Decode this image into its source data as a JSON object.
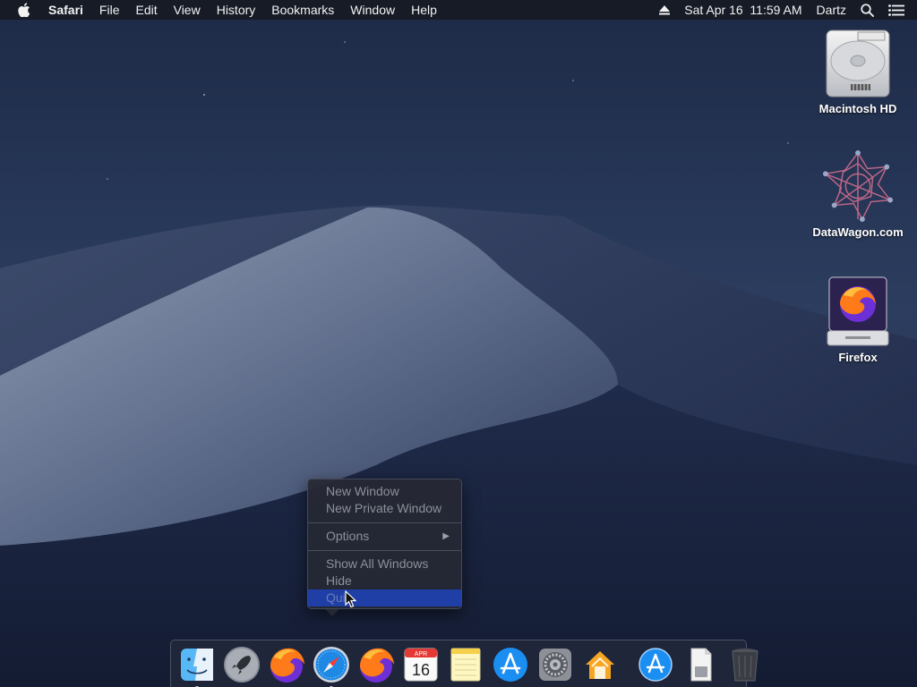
{
  "menubar": {
    "app_name": "Safari",
    "menus": [
      "File",
      "Edit",
      "View",
      "History",
      "Bookmarks",
      "Window",
      "Help"
    ],
    "datetime": "Sat Apr 16  11:59 AM",
    "user": "Dartz",
    "icons": [
      "apple-icon",
      "eject-icon",
      "spotlight-search-icon",
      "notification-center-icon"
    ]
  },
  "desktop": {
    "icons": [
      {
        "label": "Macintosh HD",
        "icon": "hard-drive-icon"
      },
      {
        "label": "DataWagon.com",
        "icon": "network-share-icon"
      },
      {
        "label": "Firefox",
        "icon": "firefox-disk-icon"
      }
    ]
  },
  "context_menu": {
    "items": [
      {
        "label": "New Window"
      },
      {
        "label": "New Private Window"
      },
      {
        "label": "Options",
        "submenu": true
      },
      {
        "label": "Show All Windows"
      },
      {
        "label": "Hide"
      },
      {
        "label": "Quit",
        "highlighted": true
      }
    ],
    "submenu_arrow": "▶"
  },
  "calendar": {
    "month": "APR",
    "day": "16"
  },
  "dock": {
    "apps": [
      {
        "name": "Finder",
        "icon": "finder-icon",
        "running": true
      },
      {
        "name": "Launchpad",
        "icon": "launchpad-icon",
        "running": false
      },
      {
        "name": "Firefox",
        "icon": "firefox-icon",
        "running": false
      },
      {
        "name": "Safari",
        "icon": "safari-icon",
        "running": true
      },
      {
        "name": "Firefox",
        "icon": "firefox-icon",
        "running": false
      },
      {
        "name": "Calendar",
        "icon": "calendar-icon",
        "running": false
      },
      {
        "name": "Notes",
        "icon": "notes-icon",
        "running": false
      },
      {
        "name": "App Store",
        "icon": "app-store-icon",
        "running": false
      },
      {
        "name": "System Preferences",
        "icon": "system-preferences-icon",
        "running": false
      },
      {
        "name": "Home",
        "icon": "home-icon",
        "running": false
      },
      {
        "name": "Applications",
        "icon": "applications-folder-icon",
        "running": false
      },
      {
        "name": "Documents",
        "icon": "document-stack-icon",
        "running": false
      },
      {
        "name": "Trash",
        "icon": "trash-icon",
        "running": false
      }
    ]
  },
  "colors": {
    "menu_highlight": "#1f3fa6",
    "wallpaper_sky": "#1f2d4b",
    "firefox_orange": "#ff7a18",
    "firefox_purple": "#6d2fd6"
  }
}
